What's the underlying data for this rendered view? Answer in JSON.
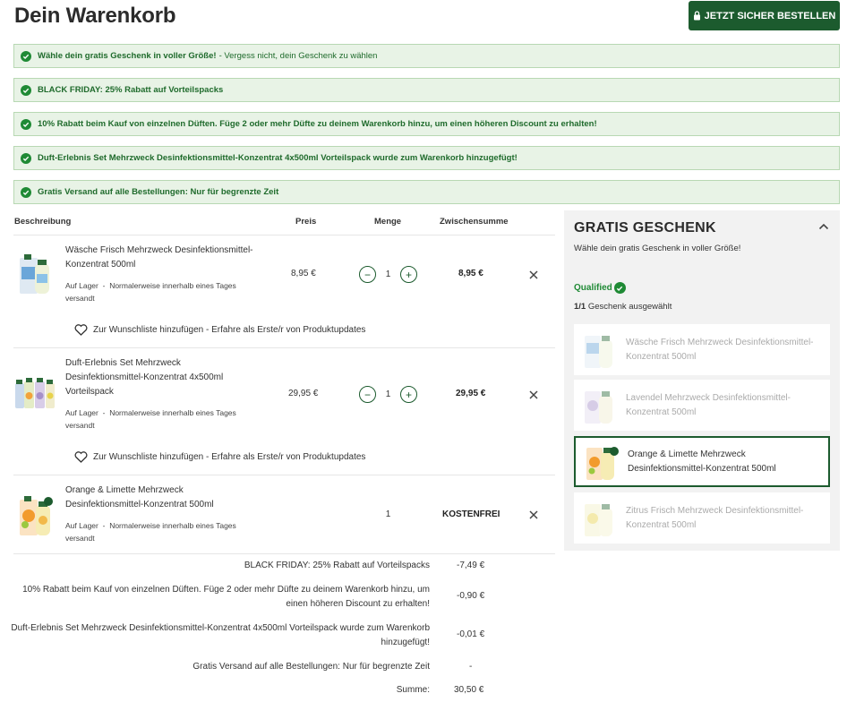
{
  "header": {
    "title": "Dein Warenkorb",
    "order_button": "JETZT SICHER BESTELLEN"
  },
  "notices": [
    {
      "bold": "Wähle dein gratis Geschenk in voller Größe!",
      "sub": "- Vergess nicht, dein Geschenk zu wählen"
    },
    {
      "bold": "BLACK FRIDAY: 25% Rabatt auf Vorteilspacks",
      "sub": ""
    },
    {
      "bold": "10% Rabatt beim Kauf von einzelnen Düften. Füge 2 oder mehr Düfte zu deinem Warenkorb hinzu, um einen höheren Discount zu erhalten!",
      "sub": ""
    },
    {
      "bold": "Duft-Erlebnis Set Mehrzweck Desinfektionsmittel-Konzentrat 4x500ml Vorteilspack wurde zum Warenkorb hinzugefügt!",
      "sub": ""
    },
    {
      "bold": "Gratis Versand auf alle Bestellungen: Nur für begrenzte Zeit",
      "sub": ""
    }
  ],
  "table": {
    "headers": {
      "description": "Beschreibung",
      "price": "Preis",
      "quantity": "Menge",
      "subtotal": "Zwischensumme"
    },
    "items": [
      {
        "name": "Wäsche Frisch Mehrzweck Desinfektionsmittel-Konzentrat 500ml",
        "stock": "Auf Lager",
        "delivery": "Normalerweise innerhalb eines Tages versandt",
        "price": "8,95 €",
        "qty": "1",
        "subtotal": "8,95 €",
        "wishlist": "Zur Wunschliste hinzufügen - Erfahre als Erste/r von Produktupdates"
      },
      {
        "name": "Duft-Erlebnis Set Mehrzweck Desinfektionsmittel-Konzentrat 4x500ml Vorteilspack",
        "stock": "Auf Lager",
        "delivery": "Normalerweise innerhalb eines Tages versandt",
        "price": "29,95 €",
        "qty": "1",
        "subtotal": "29,95 €",
        "wishlist": "Zur Wunschliste hinzufügen - Erfahre als Erste/r von Produktupdates"
      },
      {
        "name": "Orange & Limette Mehrzweck Desinfektionsmittel-Konzentrat 500ml",
        "stock": "Auf Lager",
        "delivery": "Normalerweise innerhalb eines Tages versandt",
        "price": "",
        "qty": "1",
        "subtotal": "KOSTENFREI",
        "wishlist": ""
      }
    ],
    "stock_separator": "-"
  },
  "summary": {
    "rows": [
      {
        "label": "BLACK FRIDAY: 25% Rabatt auf Vorteilspacks",
        "value": "-7,49 €"
      },
      {
        "label": "10% Rabatt beim Kauf von einzelnen Düften. Füge 2 oder mehr Düfte zu deinem Warenkorb hinzu, um einen höheren Discount zu erhalten!",
        "value": "-0,90 €"
      },
      {
        "label": "Duft-Erlebnis Set Mehrzweck Desinfektionsmittel-Konzentrat 4x500ml Vorteilspack wurde zum Warenkorb hinzugefügt!",
        "value": "-0,01 €"
      },
      {
        "label": "Gratis Versand auf alle Bestellungen: Nur für begrenzte Zeit",
        "value": "-"
      },
      {
        "label": "Summe:",
        "value": "30,50 €"
      }
    ]
  },
  "gift": {
    "title": "GRATIS GESCHENK",
    "subtitle": "Wähle dein gratis Geschenk in voller Größe!",
    "qualified": "Qualified",
    "count_bold": "1/1",
    "count_text": "Geschenk ausgewählt",
    "options": [
      {
        "name": "Wäsche Frisch Mehrzweck Desinfektionsmittel-Konzentrat 500ml",
        "selected": false
      },
      {
        "name": "Lavendel Mehrzweck Desinfektionsmittel-Konzentrat 500ml",
        "selected": false
      },
      {
        "name": "Orange & Limette Mehrzweck Desinfektionsmittel-Konzentrat 500ml",
        "selected": true
      },
      {
        "name": "Zitrus Frisch Mehrzweck Desinfektionsmittel-Konzentrat 500ml",
        "selected": false
      }
    ]
  },
  "colors": {
    "brand_green": "#1c5b2e",
    "check_green": "#1f8a35",
    "notice_bg": "#e8f3e6",
    "panel_bg": "#f2f2f2"
  }
}
